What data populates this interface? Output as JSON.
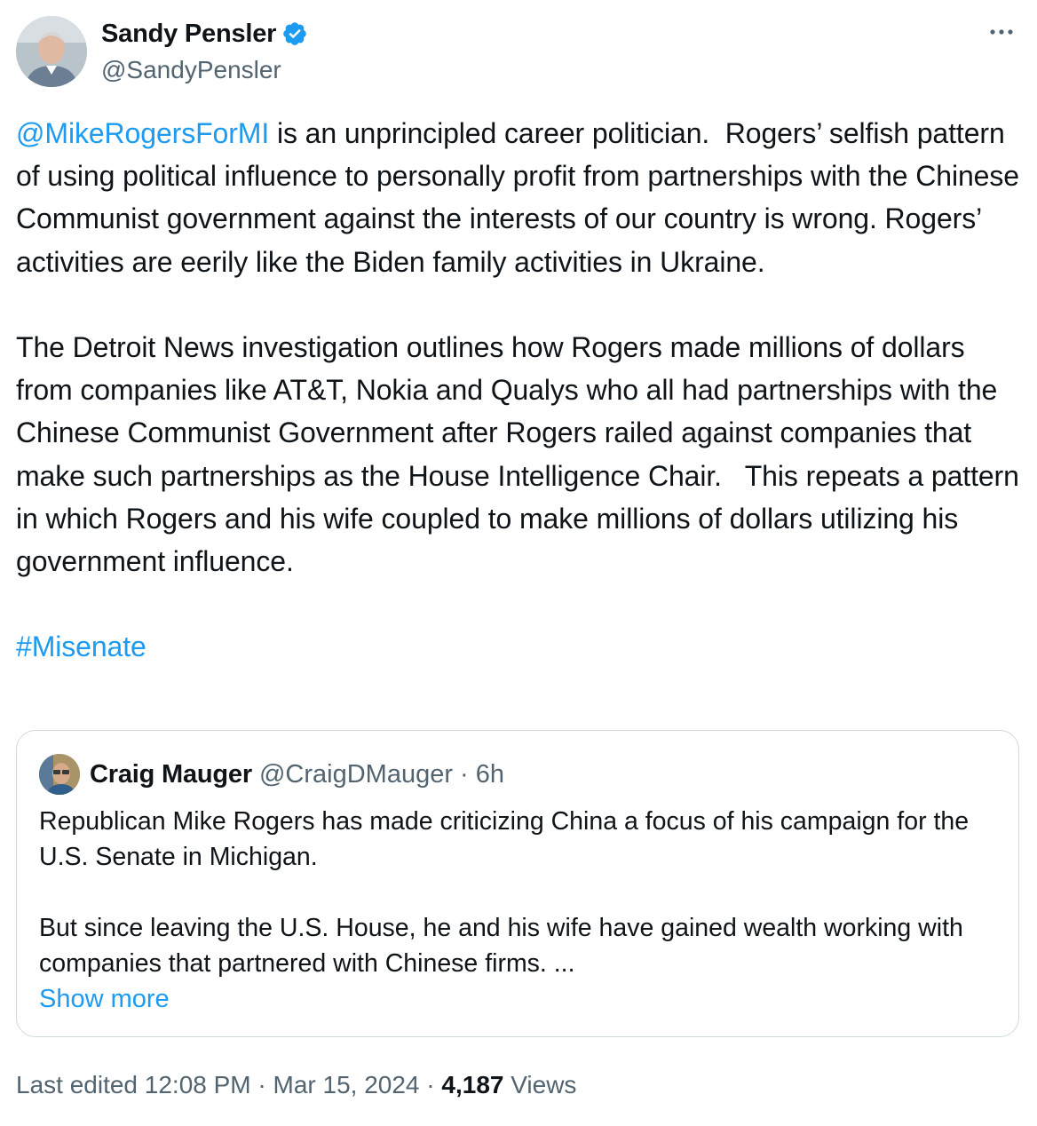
{
  "author": {
    "name": "Sandy Pensler",
    "handle": "@SandyPensler",
    "avatar_icon": "person-avatar",
    "verified_icon": "verified-badge-icon",
    "verified_color": "#1d9bf0"
  },
  "more_icon": "ellipsis-icon",
  "tweet": {
    "mention": "@MikeRogersForMI",
    "text_after_mention": " is an unprincipled career politician.  Rogers’ selfish pattern of using political influence to personally profit from partnerships with the Chinese Communist government against the interests of our country is wrong. Rogers’ activities are eerily like the Biden family activities in Ukraine.\n\nThe Detroit News investigation outlines how Rogers made millions of dollars from companies like AT&T, Nokia and Qualys who all had partnerships with the Chinese Communist Government after Rogers railed against companies that make such partnerships as the House Intelligence Chair.   This repeats a pattern in which Rogers and his wife coupled to make millions of dollars utilizing his government influence.\n\n",
    "hashtag": "#Misenate"
  },
  "quoted": {
    "name": "Craig Mauger",
    "handle": "@CraigDMauger",
    "separator": " · ",
    "time": "6h",
    "text": "Republican Mike Rogers has made criticizing China a focus of his campaign for the U.S. Senate in Michigan.\n\nBut since leaving the U.S. House, he and his wife have gained wealth working with companies that partnered with Chinese firms. ...",
    "show_more": "Show more"
  },
  "meta": {
    "edited": "Last edited 12:08 PM · Mar 15, 2024 · ",
    "views_count": "4,187",
    "views_label": " Views"
  },
  "colors": {
    "link": "#1d9bf0",
    "secondary_text": "#536471",
    "primary_text": "#0f1419",
    "border": "#cfd9de"
  }
}
